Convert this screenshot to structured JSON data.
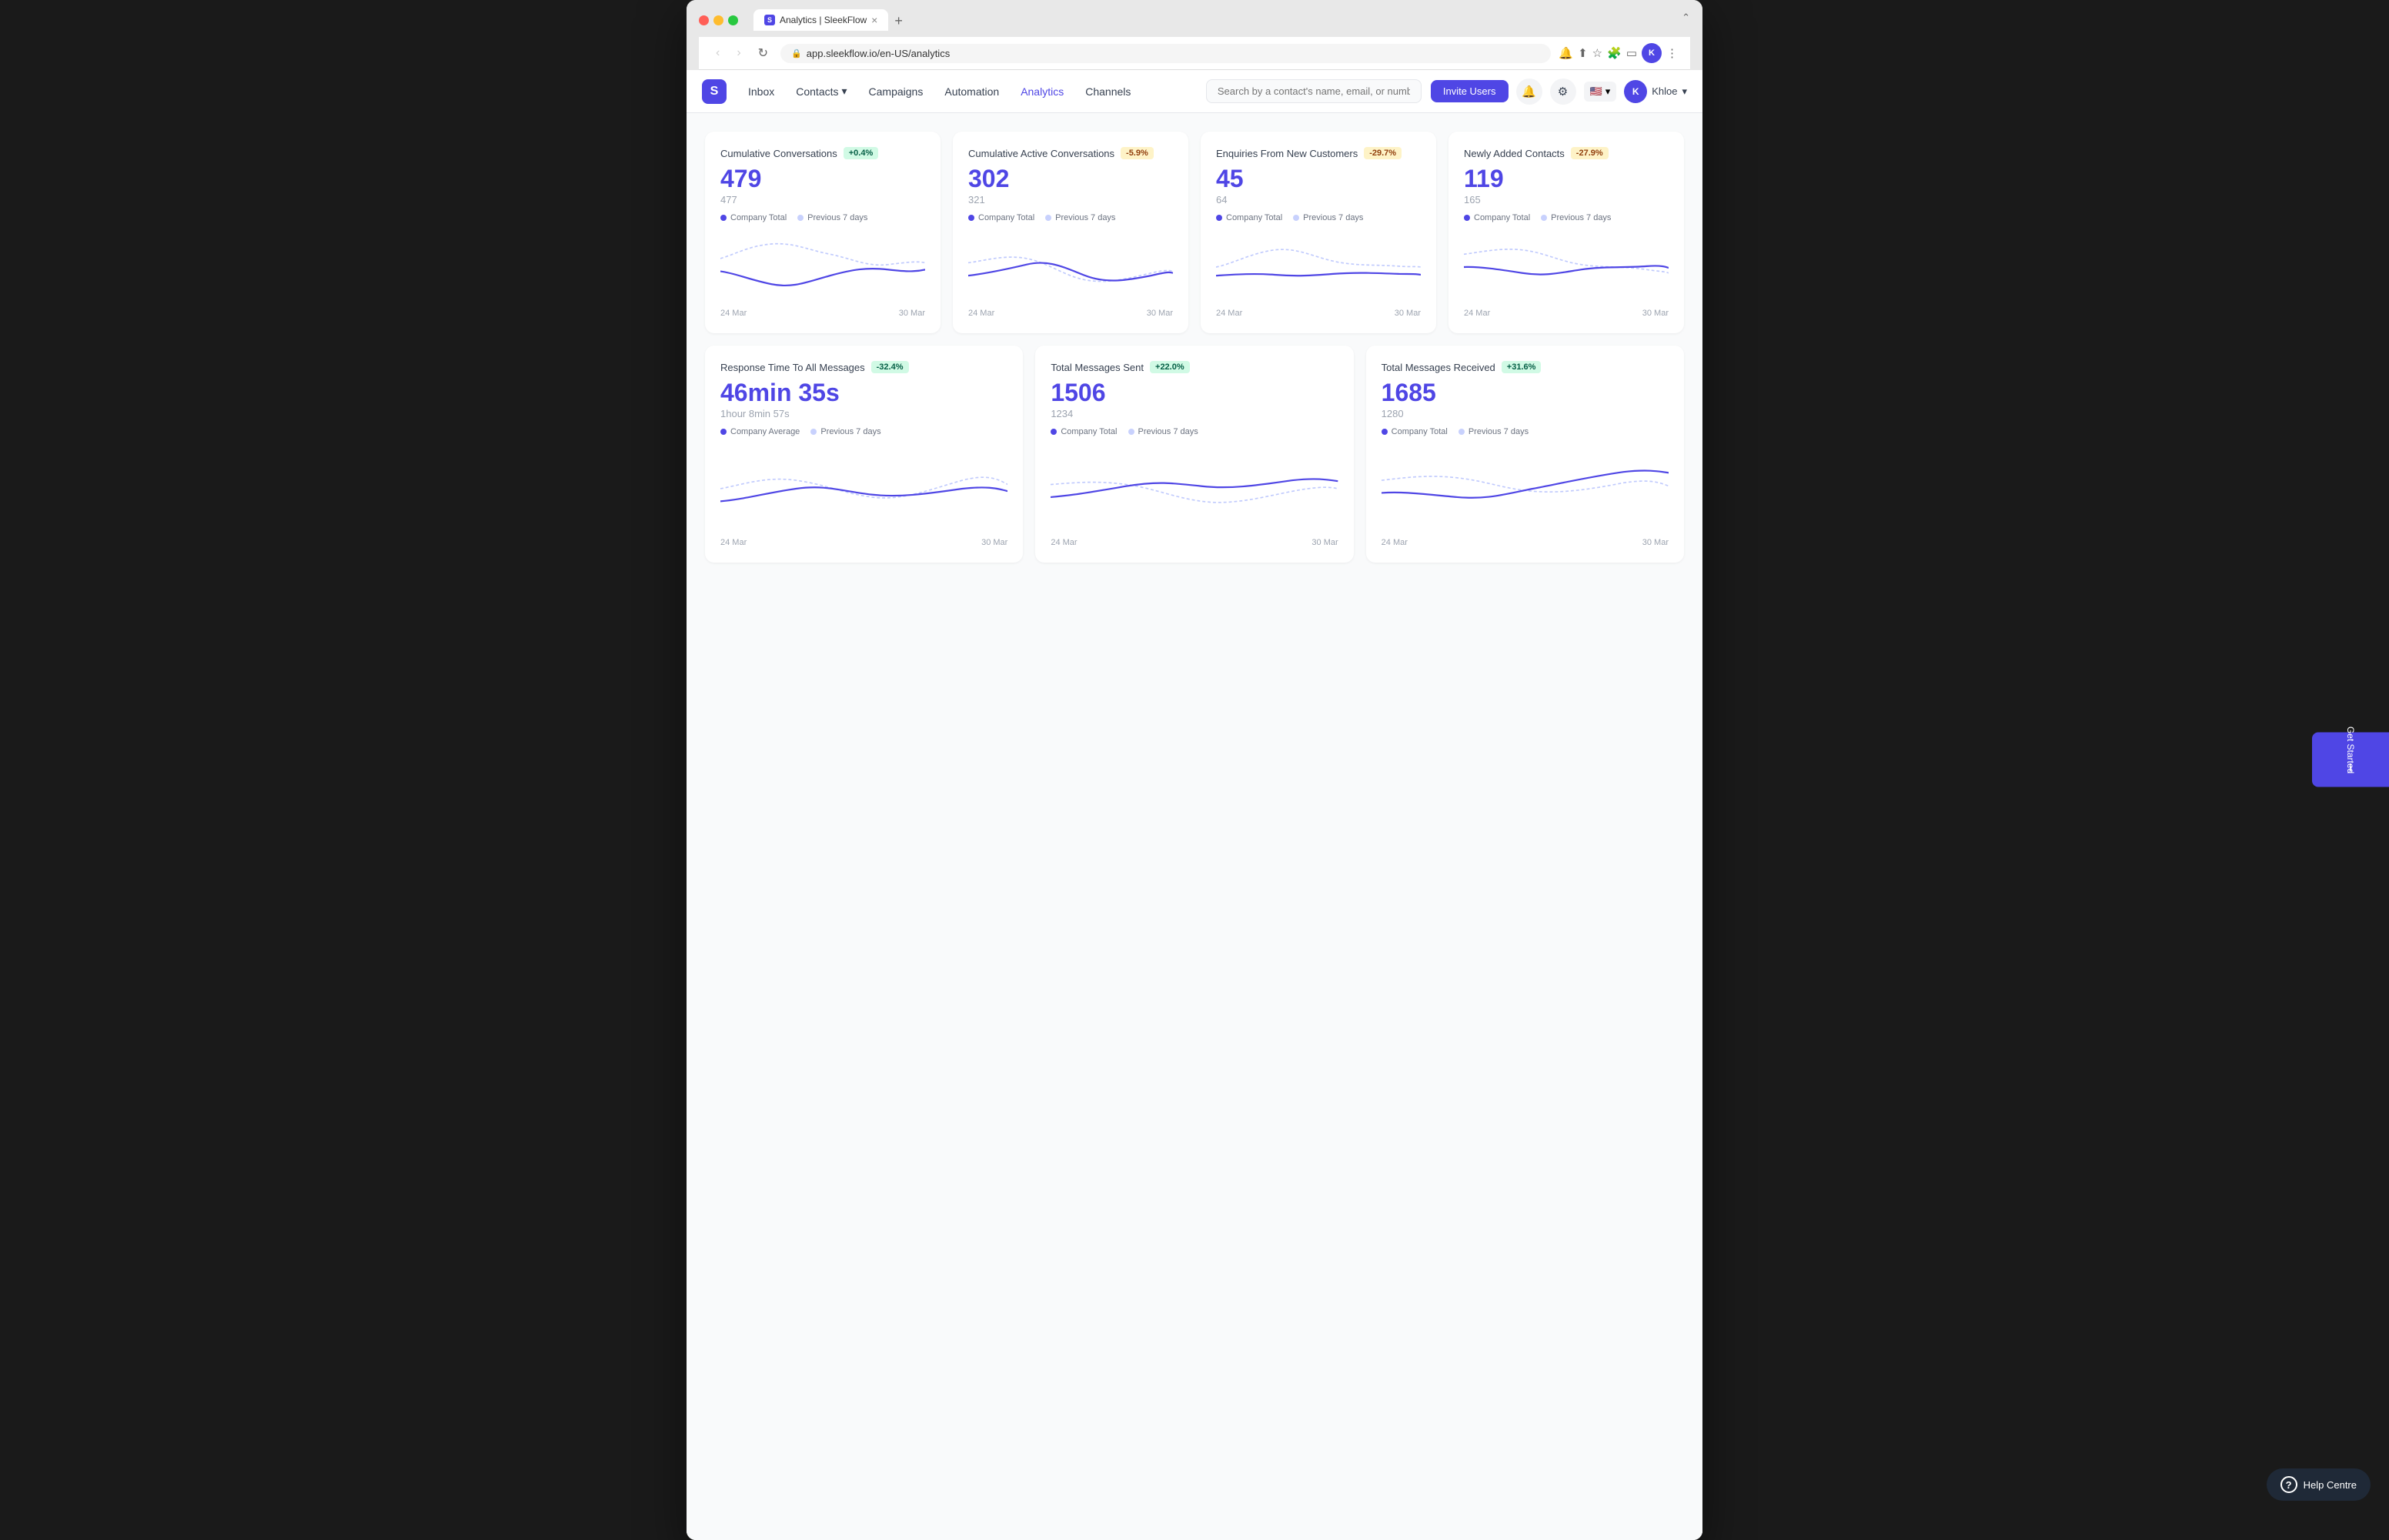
{
  "browser": {
    "tab_favicon": "S",
    "tab_title": "Analytics | SleekFlow",
    "tab_close": "×",
    "tab_new": "+",
    "url": "app.sleekflow.io/en-US/analytics",
    "nav_back": "‹",
    "nav_forward": "›",
    "nav_refresh": "↻",
    "overflow_menu": "⋯"
  },
  "nav": {
    "logo": "S",
    "links": [
      {
        "label": "Inbox",
        "active": false
      },
      {
        "label": "Contacts",
        "active": false,
        "has_arrow": true
      },
      {
        "label": "Campaigns",
        "active": false
      },
      {
        "label": "Automation",
        "active": false
      },
      {
        "label": "Analytics",
        "active": true
      },
      {
        "label": "Channels",
        "active": false
      }
    ],
    "search_placeholder": "Search by a contact's name, email, or number",
    "invite_btn": "Invite Users",
    "user_name": "Khloe",
    "user_initial": "K"
  },
  "cards": [
    {
      "id": "cumulative-conversations",
      "title": "Cumulative Conversations",
      "badge": "+0.4%",
      "badge_type": "green",
      "value": "479",
      "subvalue": "477",
      "legend1": "Company Total",
      "legend2": "Previous 7 days",
      "date_start": "24 Mar",
      "date_end": "30 Mar",
      "chart_type": "conv1"
    },
    {
      "id": "cumulative-active-conversations",
      "title": "Cumulative Active Conversations",
      "badge": "-5.9%",
      "badge_type": "orange",
      "value": "302",
      "subvalue": "321",
      "legend1": "Company Total",
      "legend2": "Previous 7 days",
      "date_start": "24 Mar",
      "date_end": "30 Mar",
      "chart_type": "conv2"
    },
    {
      "id": "enquiries-new-customers",
      "title": "Enquiries From New Customers",
      "badge": "-29.7%",
      "badge_type": "orange",
      "value": "45",
      "subvalue": "64",
      "legend1": "Company Total",
      "legend2": "Previous 7 days",
      "date_start": "24 Mar",
      "date_end": "30 Mar",
      "chart_type": "conv3"
    },
    {
      "id": "newly-added-contacts",
      "title": "Newly Added Contacts",
      "badge": "-27.9%",
      "badge_type": "orange",
      "value": "119",
      "subvalue": "165",
      "legend1": "Company Total",
      "legend2": "Previous 7 days",
      "date_start": "24 Mar",
      "date_end": "30 Mar",
      "chart_type": "conv4"
    }
  ],
  "cards_bottom": [
    {
      "id": "response-time",
      "title": "Response Time To All Messages",
      "badge": "-32.4%",
      "badge_type": "green",
      "value": "46min 35s",
      "subvalue": "1hour 8min 57s",
      "legend1": "Company Average",
      "legend2": "Previous 7 days",
      "date_start": "24 Mar",
      "date_end": "30 Mar",
      "chart_type": "resp1"
    },
    {
      "id": "total-messages-sent",
      "title": "Total Messages Sent",
      "badge": "+22.0%",
      "badge_type": "green",
      "value": "1506",
      "subvalue": "1234",
      "legend1": "Company Total",
      "legend2": "Previous 7 days",
      "date_start": "24 Mar",
      "date_end": "30 Mar",
      "chart_type": "sent1"
    },
    {
      "id": "total-messages-received",
      "title": "Total Messages Received",
      "badge": "+31.6%",
      "badge_type": "green",
      "value": "1685",
      "subvalue": "1280",
      "legend1": "Company Total",
      "legend2": "Previous 7 days",
      "date_start": "24 Mar",
      "date_end": "30 Mar",
      "chart_type": "recv1"
    }
  ],
  "sidebar_btn": "Get Started",
  "help_btn": "Help Centre"
}
